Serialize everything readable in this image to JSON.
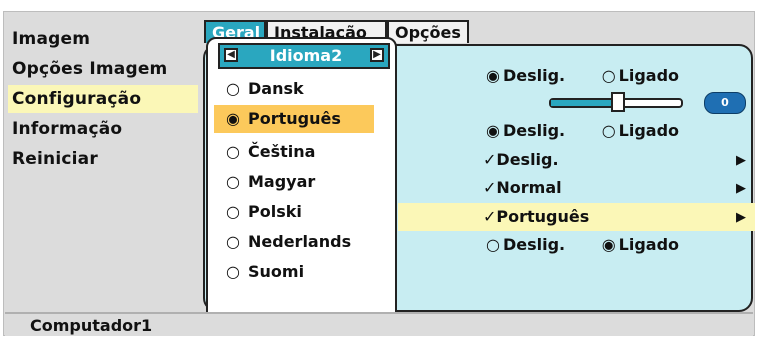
{
  "menu": {
    "items": [
      {
        "label": "Imagem"
      },
      {
        "label": "Opções Imagem"
      },
      {
        "label": "Configuração"
      },
      {
        "label": "Informação"
      },
      {
        "label": "Reiniciar"
      }
    ],
    "selected_index": 2
  },
  "tabs": [
    {
      "label": "Geral"
    },
    {
      "label": "Instalação"
    },
    {
      "label": "Opções"
    }
  ],
  "popup": {
    "title": "Idioma2",
    "languages": [
      {
        "label": "Dansk",
        "selected": false
      },
      {
        "label": "Português",
        "selected": true
      },
      {
        "label": "Čeština",
        "selected": false
      },
      {
        "label": "Magyar",
        "selected": false
      },
      {
        "label": "Polski",
        "selected": false
      },
      {
        "label": "Nederlands",
        "selected": false
      },
      {
        "label": "Suomi",
        "selected": false
      }
    ]
  },
  "settings": {
    "row1": {
      "option_a": "Deslig.",
      "option_b": "Ligado",
      "selected": "Deslig."
    },
    "slider": {
      "value": "0"
    },
    "row3": {
      "option_a": "Deslig.",
      "option_b": "Ligado",
      "selected": "Deslig."
    },
    "row4": {
      "value": "✓Deslig."
    },
    "row5": {
      "value": "✓Normal"
    },
    "row6": {
      "value": "✓Português"
    },
    "row7": {
      "option_a": "Deslig.",
      "option_b": "Ligado",
      "selected": "Ligado"
    }
  },
  "status": {
    "source": "Computador1"
  },
  "colors": {
    "accent": "#2aa7bf",
    "highlight": "#fbf7b7",
    "selection": "#fcc95b",
    "panel": "#c8edf2"
  },
  "icons": {
    "radio_on": "◉",
    "radio_off": "○",
    "arrow_right": "▶",
    "nav_left": "◀",
    "nav_right": "▶",
    "check": "✓"
  }
}
